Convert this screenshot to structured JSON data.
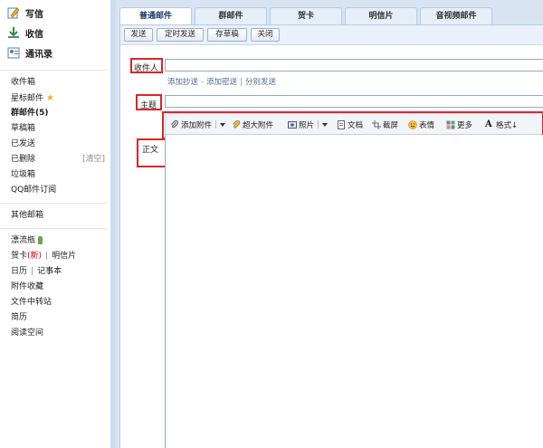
{
  "sidebar": {
    "actions": [
      {
        "label": "写信",
        "icon": "pencil-icon"
      },
      {
        "label": "收信",
        "icon": "download-icon"
      },
      {
        "label": "通讯录",
        "icon": "contacts-icon"
      }
    ],
    "group1": [
      {
        "label": "收件箱"
      },
      {
        "label": "星标邮件"
      },
      {
        "label": "群邮件(5)"
      },
      {
        "label": "草稿箱"
      },
      {
        "label": "已发送"
      },
      {
        "label": "已删除",
        "extra": "[清空]"
      },
      {
        "label": "垃圾箱"
      },
      {
        "label": "QQ邮件订阅"
      }
    ],
    "group2": [
      {
        "label": "其他邮箱"
      }
    ],
    "group3": [
      {
        "label": "漂流瓶"
      },
      {
        "label": "贺卡",
        "badge": "(新)",
        "extra": "明信片"
      },
      {
        "label": "日历",
        "extra": "记事本"
      },
      {
        "label": "附件收藏"
      },
      {
        "label": "文件中转站"
      },
      {
        "label": "简历"
      },
      {
        "label": "阅读空间"
      }
    ]
  },
  "tabs": [
    {
      "label": "普通邮件"
    },
    {
      "label": "群邮件"
    },
    {
      "label": "贺卡"
    },
    {
      "label": "明信片"
    },
    {
      "label": "音视频邮件"
    }
  ],
  "toolbar": {
    "send": "发送",
    "scheduled_send": "定时发送",
    "save_draft": "存草稿",
    "close": "关闭"
  },
  "compose": {
    "to_label": "收件人",
    "subject_label": "主题",
    "body_label": "正文",
    "add_cc": "添加抄送",
    "dash": "-",
    "add_bcc": "添加密送",
    "pipe": "|",
    "separate_send": "分别发送",
    "to_value": "",
    "subject_value": ""
  },
  "format_bar": [
    {
      "label": "添加附件",
      "icon": "paperclip-icon"
    },
    {
      "label": "超大附件",
      "icon": "large-attachment-icon"
    },
    {
      "label": "照片",
      "icon": "photo-icon"
    },
    {
      "label": "文档",
      "icon": "document-icon"
    },
    {
      "label": "截屏",
      "icon": "screenshot-icon"
    },
    {
      "label": "表情",
      "icon": "emoji-icon"
    },
    {
      "label": "更多",
      "icon": "more-icon"
    },
    {
      "label": "格式↓",
      "icon": "text-format-icon"
    }
  ],
  "colors": {
    "highlight": "#d9262b",
    "panel_bg": "#d8e4f2",
    "link": "#4d6b8f"
  }
}
